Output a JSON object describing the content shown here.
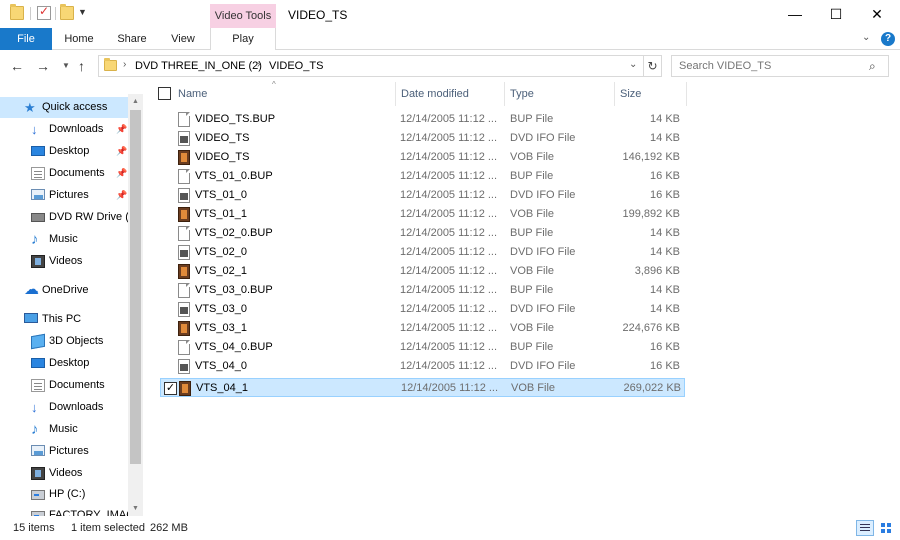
{
  "window": {
    "title": "VIDEO_TS",
    "context_tab_title": "Video Tools",
    "controls": {
      "minimize": "—",
      "maximize": "☐",
      "close": "✕"
    }
  },
  "ribbon": {
    "tabs": [
      "File",
      "Home",
      "Share",
      "View",
      "Play"
    ],
    "active_tab_color": "#1979ca",
    "context_tab_color": "#f7d0e3",
    "help": "?"
  },
  "address": {
    "crumbs": [
      "DVD THREE_IN_ONE (2)",
      "VIDEO_TS"
    ],
    "separator": "›",
    "search_placeholder": "Search VIDEO_TS"
  },
  "nav": {
    "items": [
      {
        "label": "Quick access",
        "icon": "star-icon",
        "pinned": false
      },
      {
        "label": "Downloads",
        "icon": "download-arrow-icon",
        "pinned": true
      },
      {
        "label": "Desktop",
        "icon": "desktop-icon",
        "pinned": true
      },
      {
        "label": "Documents",
        "icon": "documents-icon",
        "pinned": true
      },
      {
        "label": "Pictures",
        "icon": "pictures-icon",
        "pinned": true
      },
      {
        "label": "DVD RW Drive (E",
        "icon": "dvd-drive-icon",
        "pinned": false
      },
      {
        "label": "Music",
        "icon": "music-note-icon",
        "pinned": false
      },
      {
        "label": "Videos",
        "icon": "videos-icon",
        "pinned": false
      },
      {
        "label": "OneDrive",
        "icon": "onedrive-cloud-icon",
        "pinned": false
      },
      {
        "label": "This PC",
        "icon": "this-pc-icon",
        "pinned": false
      },
      {
        "label": "3D Objects",
        "icon": "3d-objects-icon",
        "pinned": false
      },
      {
        "label": "Desktop",
        "icon": "desktop-icon",
        "pinned": false
      },
      {
        "label": "Documents",
        "icon": "documents-icon",
        "pinned": false
      },
      {
        "label": "Downloads",
        "icon": "download-arrow-icon",
        "pinned": false
      },
      {
        "label": "Music",
        "icon": "music-note-icon",
        "pinned": false
      },
      {
        "label": "Pictures",
        "icon": "pictures-icon",
        "pinned": false
      },
      {
        "label": "Videos",
        "icon": "videos-icon",
        "pinned": false
      },
      {
        "label": "HP (C:)",
        "icon": "hard-drive-icon",
        "pinned": false
      },
      {
        "label": "FACTORY_IMAG",
        "icon": "hard-drive-icon",
        "pinned": false
      }
    ],
    "selected_index": 0
  },
  "columns": [
    "Name",
    "Date modified",
    "Type",
    "Size"
  ],
  "files": [
    {
      "name": "VIDEO_TS.BUP",
      "date": "12/14/2005 11:12 ...",
      "type": "BUP File",
      "size": "14 KB",
      "icon": "bup-file-icon"
    },
    {
      "name": "VIDEO_TS",
      "date": "12/14/2005 11:12 ...",
      "type": "DVD IFO File",
      "size": "14 KB",
      "icon": "ifo-file-icon"
    },
    {
      "name": "VIDEO_TS",
      "date": "12/14/2005 11:12 ...",
      "type": "VOB File",
      "size": "146,192 KB",
      "icon": "vob-file-icon"
    },
    {
      "name": "VTS_01_0.BUP",
      "date": "12/14/2005 11:12 ...",
      "type": "BUP File",
      "size": "16 KB",
      "icon": "bup-file-icon"
    },
    {
      "name": "VTS_01_0",
      "date": "12/14/2005 11:12 ...",
      "type": "DVD IFO File",
      "size": "16 KB",
      "icon": "ifo-file-icon"
    },
    {
      "name": "VTS_01_1",
      "date": "12/14/2005 11:12 ...",
      "type": "VOB File",
      "size": "199,892 KB",
      "icon": "vob-file-icon"
    },
    {
      "name": "VTS_02_0.BUP",
      "date": "12/14/2005 11:12 ...",
      "type": "BUP File",
      "size": "14 KB",
      "icon": "bup-file-icon"
    },
    {
      "name": "VTS_02_0",
      "date": "12/14/2005 11:12 ...",
      "type": "DVD IFO File",
      "size": "14 KB",
      "icon": "ifo-file-icon"
    },
    {
      "name": "VTS_02_1",
      "date": "12/14/2005 11:12 ...",
      "type": "VOB File",
      "size": "3,896 KB",
      "icon": "vob-file-icon"
    },
    {
      "name": "VTS_03_0.BUP",
      "date": "12/14/2005 11:12 ...",
      "type": "BUP File",
      "size": "14 KB",
      "icon": "bup-file-icon"
    },
    {
      "name": "VTS_03_0",
      "date": "12/14/2005 11:12 ...",
      "type": "DVD IFO File",
      "size": "14 KB",
      "icon": "ifo-file-icon"
    },
    {
      "name": "VTS_03_1",
      "date": "12/14/2005 11:12 ...",
      "type": "VOB File",
      "size": "224,676 KB",
      "icon": "vob-file-icon"
    },
    {
      "name": "VTS_04_0.BUP",
      "date": "12/14/2005 11:12 ...",
      "type": "BUP File",
      "size": "16 KB",
      "icon": "bup-file-icon"
    },
    {
      "name": "VTS_04_0",
      "date": "12/14/2005 11:12 ...",
      "type": "DVD IFO File",
      "size": "16 KB",
      "icon": "ifo-file-icon"
    },
    {
      "name": "VTS_04_1",
      "date": "12/14/2005 11:12 ...",
      "type": "VOB File",
      "size": "269,022 KB",
      "icon": "vob-file-icon",
      "selected": true
    }
  ],
  "status": {
    "count": "15 items",
    "selected": "1 item selected",
    "size": "262 MB"
  },
  "colors": {
    "selection_bg": "#cce8ff",
    "selection_border": "#99d1ff",
    "header_text": "#4c607a",
    "muted_text": "#6d6d6d"
  }
}
